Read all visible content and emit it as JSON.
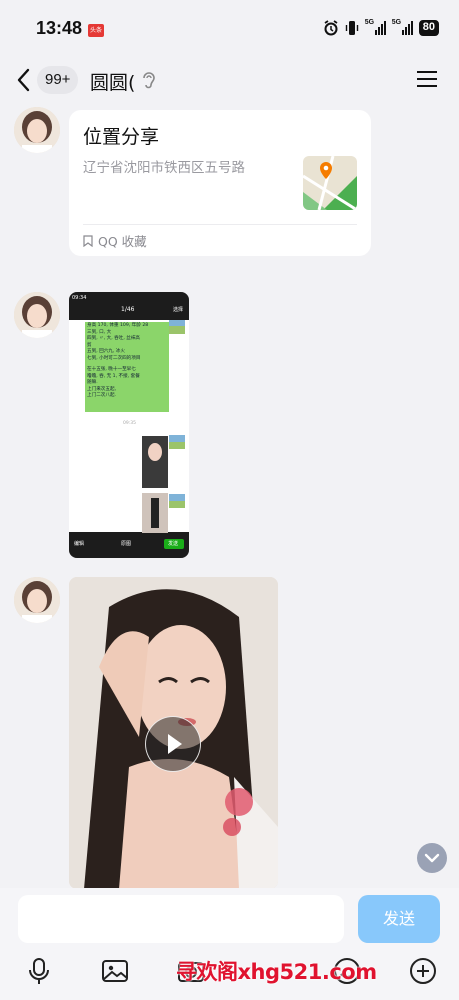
{
  "status_bar": {
    "time": "13:48",
    "network_1": "5G",
    "network_2": "5G",
    "battery": "80"
  },
  "header": {
    "unread_count": "99+",
    "chat_name": "圆圆(",
    "icons": [
      "back-arrow-icon",
      "ear-icon",
      "menu-icon"
    ]
  },
  "messages": {
    "location": {
      "title": "位置分享",
      "address": "辽宁省沈阳市铁西区五号路",
      "source": "QQ 收藏"
    },
    "screenshot": {
      "time": "09:34",
      "page": "1/46",
      "select": "选择",
      "chat_lines": [
        "身高 170, 体重 109, 年龄 28",
        "三到, 口, 大",
        "四到, 〃, 大, 吞吐, 丝袜高",
        "剪",
        "五到, 回六九, 冰火",
        "七到, 小时可二次四的项目",
        "",
        "在十五张, 晚十一至早七",
        "噜噜, 吞, 无 1, 不接, 套餐",
        "随嘛.",
        "上门来次五起,",
        "上门二次八起."
      ],
      "divider": "09:35",
      "edit": "编辑",
      "original": "原图",
      "send": "发送"
    }
  },
  "input": {
    "placeholder": "",
    "send_label": "发送"
  },
  "watermark": "寻欢阁xhg521.com",
  "colors": {
    "background": "#f2f2f5",
    "send_button": "#88c8fb",
    "card": "#ffffff",
    "watermark": "#e0132f",
    "scroll_button": "#9aa2b5"
  }
}
